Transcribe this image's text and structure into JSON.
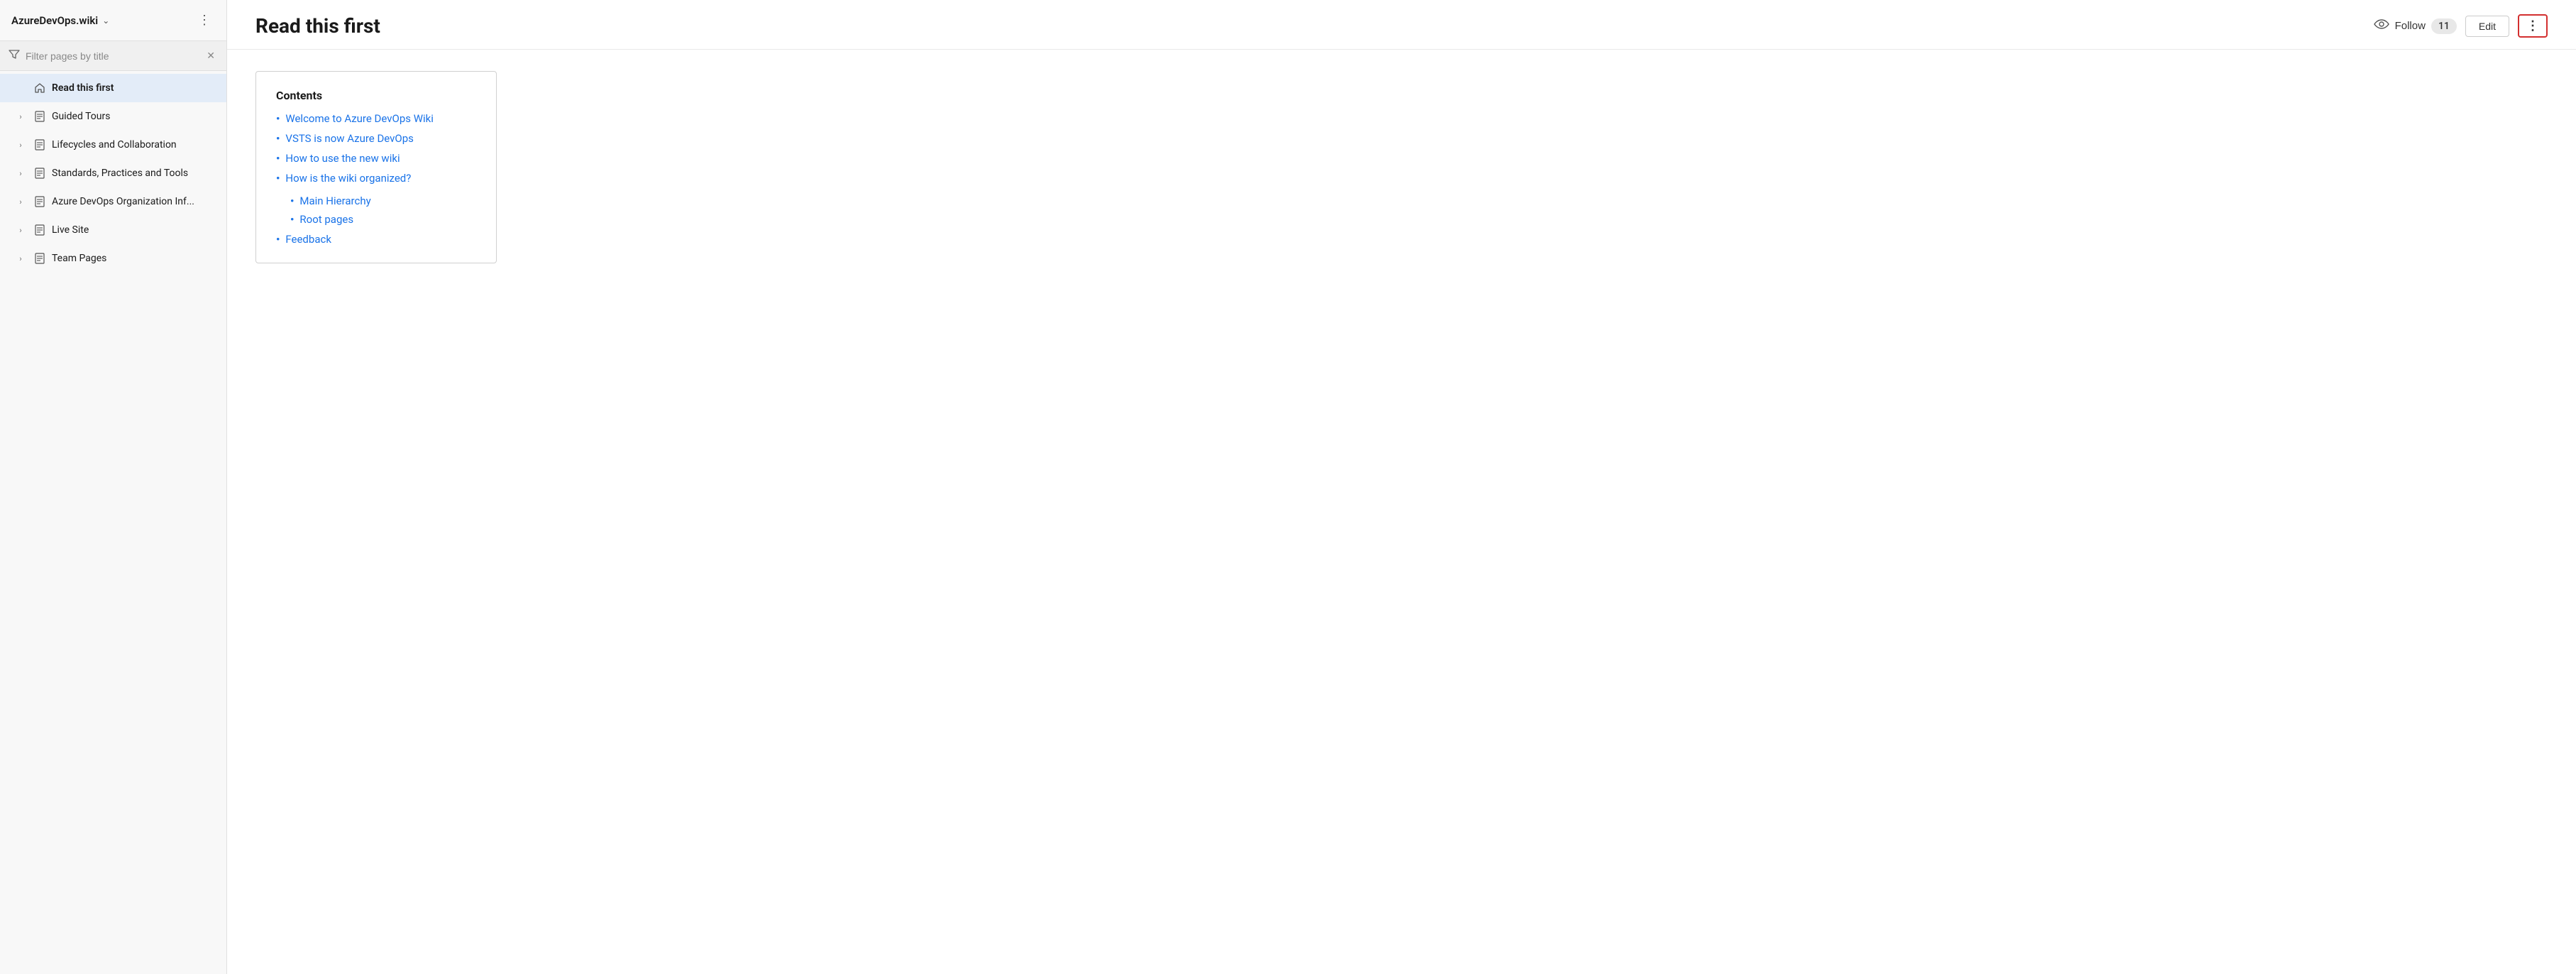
{
  "sidebar": {
    "title": "AzureDevOps.wiki",
    "filter_placeholder": "Filter pages by title",
    "nav_items": [
      {
        "id": "read-this-first",
        "label": "Read this first",
        "type": "home",
        "active": true,
        "expandable": false
      },
      {
        "id": "guided-tours",
        "label": "Guided Tours",
        "type": "page",
        "active": false,
        "expandable": true
      },
      {
        "id": "lifecycles-and-collaboration",
        "label": "Lifecycles and Collaboration",
        "type": "page",
        "active": false,
        "expandable": true
      },
      {
        "id": "standards-practices",
        "label": "Standards, Practices and Tools",
        "type": "page",
        "active": false,
        "expandable": true
      },
      {
        "id": "azure-devops-org",
        "label": "Azure DevOps Organization Inf...",
        "type": "page",
        "active": false,
        "expandable": true
      },
      {
        "id": "live-site",
        "label": "Live Site",
        "type": "page",
        "active": false,
        "expandable": true
      },
      {
        "id": "team-pages",
        "label": "Team Pages",
        "type": "page",
        "active": false,
        "expandable": true
      }
    ]
  },
  "header": {
    "page_title": "Read this first",
    "follow_label": "Follow",
    "follow_count": "11",
    "edit_label": "Edit"
  },
  "contents": {
    "title": "Contents",
    "items": [
      {
        "label": "Welcome to Azure DevOps Wiki",
        "sub_items": []
      },
      {
        "label": "VSTS is now Azure DevOps",
        "sub_items": []
      },
      {
        "label": "How to use the new wiki",
        "sub_items": []
      },
      {
        "label": "How is the wiki organized?",
        "sub_items": [
          {
            "label": "Main Hierarchy"
          },
          {
            "label": "Root pages"
          }
        ]
      },
      {
        "label": "Feedback",
        "sub_items": []
      }
    ]
  }
}
